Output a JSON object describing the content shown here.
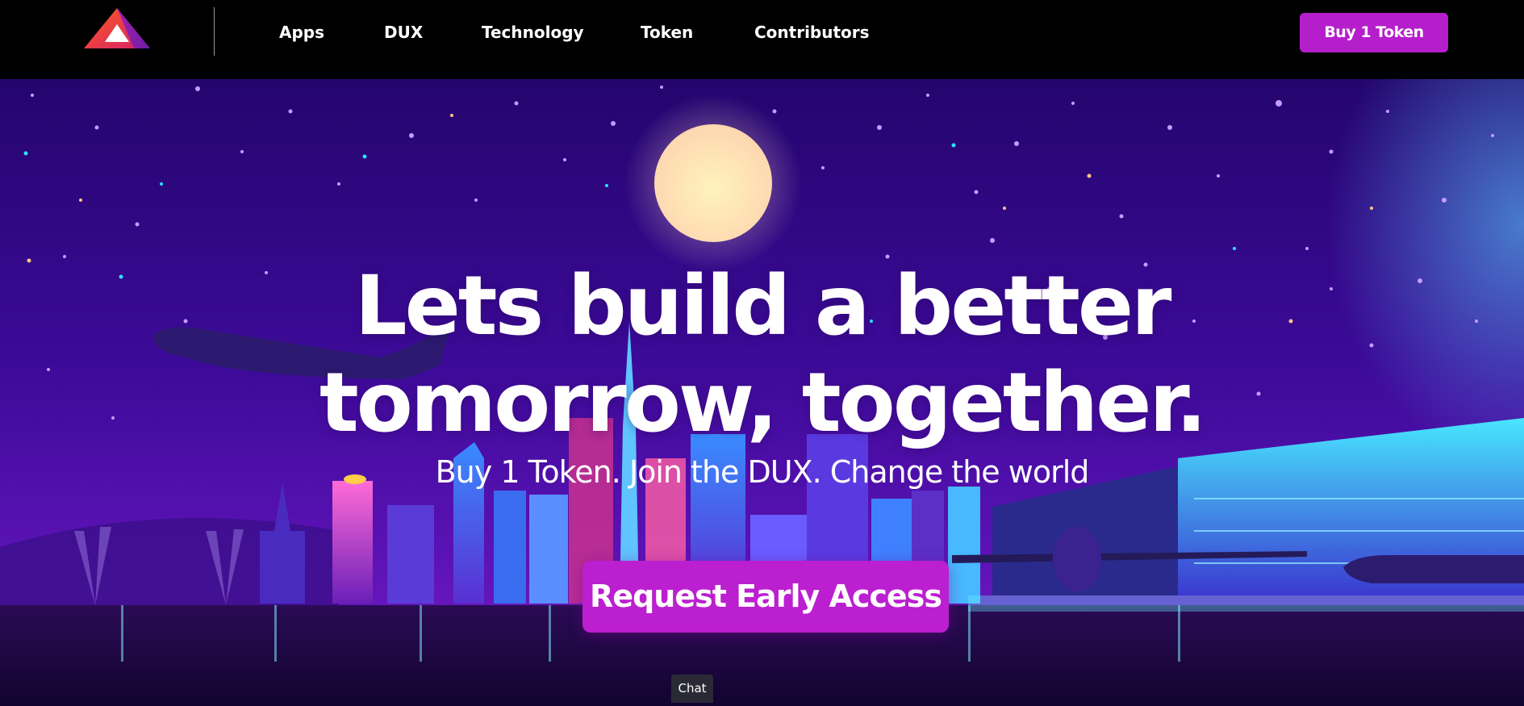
{
  "nav": {
    "logo_icon": "triangle-logo-icon",
    "links": [
      "Apps",
      "DUX",
      "Technology",
      "Token",
      "Contributors"
    ],
    "buy_label": "Buy 1 Token"
  },
  "hero": {
    "headline_line1": "Lets build a better",
    "headline_line2": "tomorrow, together.",
    "subhead": "Buy 1 Token. Join the DUX. Change the world",
    "cta_label": "Request Early Access"
  },
  "chat": {
    "label": "Chat"
  },
  "colors": {
    "nav_bg": "#000000",
    "accent": "#b51fcb",
    "sky_top": "#23046a",
    "sky_mid": "#4a0aa0",
    "moon": "#fde8b3"
  }
}
